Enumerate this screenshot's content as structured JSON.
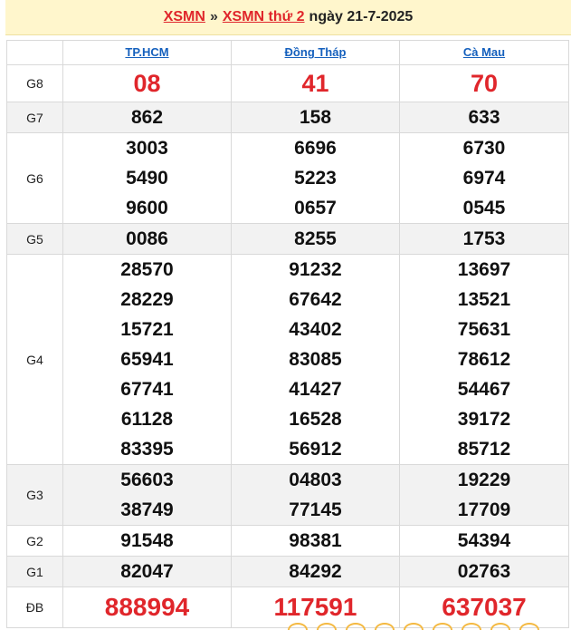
{
  "header": {
    "link1": "XSMN",
    "separator": "»",
    "link2": "XSMN thứ 2",
    "date": "ngày 21-7-2025"
  },
  "provinces": [
    "TP.HCM",
    "Đồng Tháp",
    "Cà Mau"
  ],
  "prizes": [
    {
      "label": "G8",
      "values": [
        [
          "08"
        ],
        [
          "41"
        ],
        [
          "70"
        ]
      ]
    },
    {
      "label": "G7",
      "values": [
        [
          "862"
        ],
        [
          "158"
        ],
        [
          "633"
        ]
      ]
    },
    {
      "label": "G6",
      "values": [
        [
          "3003",
          "5490",
          "9600"
        ],
        [
          "6696",
          "5223",
          "0657"
        ],
        [
          "6730",
          "6974",
          "0545"
        ]
      ]
    },
    {
      "label": "G5",
      "values": [
        [
          "0086"
        ],
        [
          "8255"
        ],
        [
          "1753"
        ]
      ]
    },
    {
      "label": "G4",
      "values": [
        [
          "28570",
          "28229",
          "15721",
          "65941",
          "67741",
          "61128",
          "83395"
        ],
        [
          "91232",
          "67642",
          "43402",
          "83085",
          "41427",
          "16528",
          "56912"
        ],
        [
          "13697",
          "13521",
          "75631",
          "78612",
          "54467",
          "39172",
          "85712"
        ]
      ]
    },
    {
      "label": "G3",
      "values": [
        [
          "56603",
          "38749"
        ],
        [
          "04803",
          "77145"
        ],
        [
          "19229",
          "17709"
        ]
      ]
    },
    {
      "label": "G2",
      "values": [
        [
          "91548"
        ],
        [
          "98381"
        ],
        [
          "54394"
        ]
      ]
    },
    {
      "label": "G1",
      "values": [
        [
          "82047"
        ],
        [
          "84292"
        ],
        [
          "02763"
        ]
      ]
    },
    {
      "label": "ĐB",
      "values": [
        [
          "888994"
        ],
        [
          "117591"
        ],
        [
          "637037"
        ]
      ]
    }
  ],
  "colors": {
    "accent_red": "#e0262b",
    "link_blue": "#1560bd",
    "header_bg": "#fff6cc",
    "alt_row_bg": "#f2f2f2"
  }
}
